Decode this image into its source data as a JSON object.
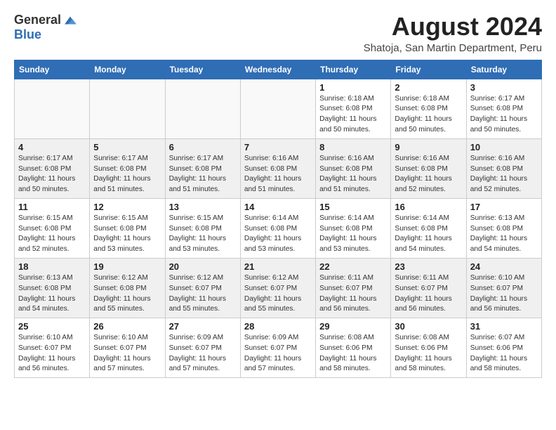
{
  "logo": {
    "general": "General",
    "blue": "Blue"
  },
  "title": "August 2024",
  "location": "Shatoja, San Martin Department, Peru",
  "days_of_week": [
    "Sunday",
    "Monday",
    "Tuesday",
    "Wednesday",
    "Thursday",
    "Friday",
    "Saturday"
  ],
  "weeks": [
    [
      {
        "day": "",
        "info": ""
      },
      {
        "day": "",
        "info": ""
      },
      {
        "day": "",
        "info": ""
      },
      {
        "day": "",
        "info": ""
      },
      {
        "day": "1",
        "info": "Sunrise: 6:18 AM\nSunset: 6:08 PM\nDaylight: 11 hours and 50 minutes."
      },
      {
        "day": "2",
        "info": "Sunrise: 6:18 AM\nSunset: 6:08 PM\nDaylight: 11 hours and 50 minutes."
      },
      {
        "day": "3",
        "info": "Sunrise: 6:17 AM\nSunset: 6:08 PM\nDaylight: 11 hours and 50 minutes."
      }
    ],
    [
      {
        "day": "4",
        "info": "Sunrise: 6:17 AM\nSunset: 6:08 PM\nDaylight: 11 hours and 50 minutes."
      },
      {
        "day": "5",
        "info": "Sunrise: 6:17 AM\nSunset: 6:08 PM\nDaylight: 11 hours and 51 minutes."
      },
      {
        "day": "6",
        "info": "Sunrise: 6:17 AM\nSunset: 6:08 PM\nDaylight: 11 hours and 51 minutes."
      },
      {
        "day": "7",
        "info": "Sunrise: 6:16 AM\nSunset: 6:08 PM\nDaylight: 11 hours and 51 minutes."
      },
      {
        "day": "8",
        "info": "Sunrise: 6:16 AM\nSunset: 6:08 PM\nDaylight: 11 hours and 51 minutes."
      },
      {
        "day": "9",
        "info": "Sunrise: 6:16 AM\nSunset: 6:08 PM\nDaylight: 11 hours and 52 minutes."
      },
      {
        "day": "10",
        "info": "Sunrise: 6:16 AM\nSunset: 6:08 PM\nDaylight: 11 hours and 52 minutes."
      }
    ],
    [
      {
        "day": "11",
        "info": "Sunrise: 6:15 AM\nSunset: 6:08 PM\nDaylight: 11 hours and 52 minutes."
      },
      {
        "day": "12",
        "info": "Sunrise: 6:15 AM\nSunset: 6:08 PM\nDaylight: 11 hours and 53 minutes."
      },
      {
        "day": "13",
        "info": "Sunrise: 6:15 AM\nSunset: 6:08 PM\nDaylight: 11 hours and 53 minutes."
      },
      {
        "day": "14",
        "info": "Sunrise: 6:14 AM\nSunset: 6:08 PM\nDaylight: 11 hours and 53 minutes."
      },
      {
        "day": "15",
        "info": "Sunrise: 6:14 AM\nSunset: 6:08 PM\nDaylight: 11 hours and 53 minutes."
      },
      {
        "day": "16",
        "info": "Sunrise: 6:14 AM\nSunset: 6:08 PM\nDaylight: 11 hours and 54 minutes."
      },
      {
        "day": "17",
        "info": "Sunrise: 6:13 AM\nSunset: 6:08 PM\nDaylight: 11 hours and 54 minutes."
      }
    ],
    [
      {
        "day": "18",
        "info": "Sunrise: 6:13 AM\nSunset: 6:08 PM\nDaylight: 11 hours and 54 minutes."
      },
      {
        "day": "19",
        "info": "Sunrise: 6:12 AM\nSunset: 6:08 PM\nDaylight: 11 hours and 55 minutes."
      },
      {
        "day": "20",
        "info": "Sunrise: 6:12 AM\nSunset: 6:07 PM\nDaylight: 11 hours and 55 minutes."
      },
      {
        "day": "21",
        "info": "Sunrise: 6:12 AM\nSunset: 6:07 PM\nDaylight: 11 hours and 55 minutes."
      },
      {
        "day": "22",
        "info": "Sunrise: 6:11 AM\nSunset: 6:07 PM\nDaylight: 11 hours and 56 minutes."
      },
      {
        "day": "23",
        "info": "Sunrise: 6:11 AM\nSunset: 6:07 PM\nDaylight: 11 hours and 56 minutes."
      },
      {
        "day": "24",
        "info": "Sunrise: 6:10 AM\nSunset: 6:07 PM\nDaylight: 11 hours and 56 minutes."
      }
    ],
    [
      {
        "day": "25",
        "info": "Sunrise: 6:10 AM\nSunset: 6:07 PM\nDaylight: 11 hours and 56 minutes."
      },
      {
        "day": "26",
        "info": "Sunrise: 6:10 AM\nSunset: 6:07 PM\nDaylight: 11 hours and 57 minutes."
      },
      {
        "day": "27",
        "info": "Sunrise: 6:09 AM\nSunset: 6:07 PM\nDaylight: 11 hours and 57 minutes."
      },
      {
        "day": "28",
        "info": "Sunrise: 6:09 AM\nSunset: 6:07 PM\nDaylight: 11 hours and 57 minutes."
      },
      {
        "day": "29",
        "info": "Sunrise: 6:08 AM\nSunset: 6:06 PM\nDaylight: 11 hours and 58 minutes."
      },
      {
        "day": "30",
        "info": "Sunrise: 6:08 AM\nSunset: 6:06 PM\nDaylight: 11 hours and 58 minutes."
      },
      {
        "day": "31",
        "info": "Sunrise: 6:07 AM\nSunset: 6:06 PM\nDaylight: 11 hours and 58 minutes."
      }
    ]
  ]
}
